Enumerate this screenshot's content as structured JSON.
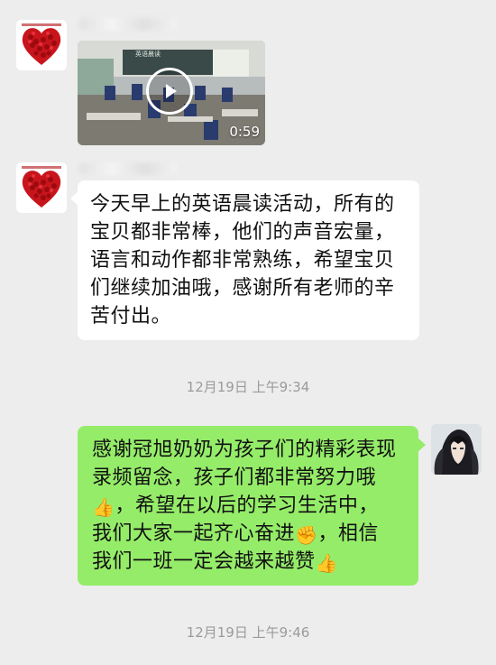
{
  "messages": {
    "video": {
      "duration": "0:59",
      "banner_text": "英语晨读"
    },
    "text1": {
      "lines": [
        "今天早上的英语晨读活动，所有的",
        "宝贝都非常棒，他们的声音宏量，",
        "语言和动作都非常熟练，希望宝贝",
        "们继续加油哦，感谢所有老师的辛",
        "苦付出。"
      ]
    },
    "timestamp1": "12月19日 上午9:34",
    "reply": {
      "line1": "感谢冠旭奶奶为孩子们的精彩表现",
      "line2": "录频留念，孩子们都非常努力哦",
      "line3_emoji": "👍",
      "line3_text": "，希望在以后的学习生活中，",
      "line4_text": "我们大家一起齐心奋进",
      "line4_emoji": "✊",
      "line4_text2": "，相信",
      "line5_text": "我们一班一定会越来越赞",
      "line5_emoji": "👍"
    },
    "timestamp2": "12月19日 上午9:46"
  },
  "colors": {
    "background": "#ededed",
    "incoming_bubble": "#ffffff",
    "outgoing_bubble": "#95ec69",
    "timestamp_text": "#9b9b9b"
  },
  "icons": [
    "heart-roses-avatar-icon",
    "play-icon",
    "anime-avatar-icon",
    "thumbs-up-icon",
    "fist-icon"
  ]
}
